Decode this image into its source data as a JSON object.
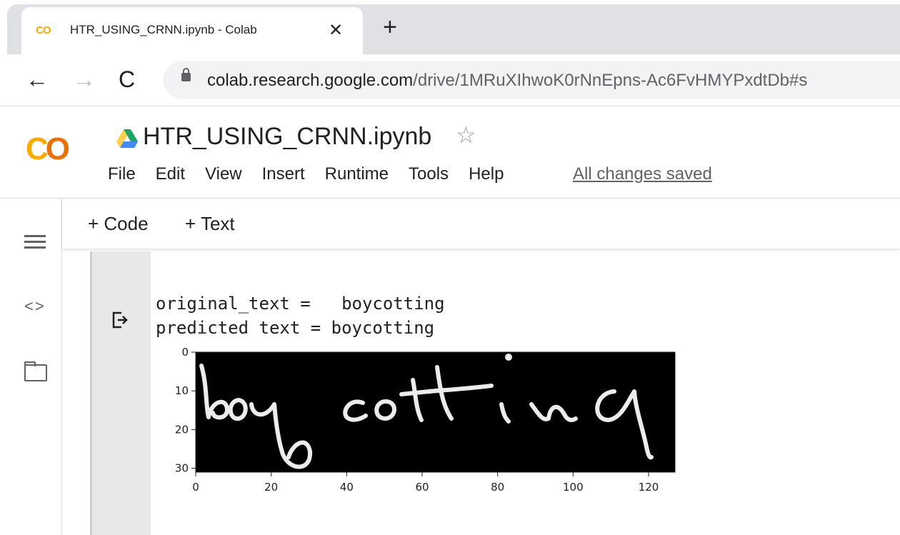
{
  "browser": {
    "tab": {
      "favicon": "CO",
      "title": "HTR_USING_CRNN.ipynb - Colab",
      "close_icon": "✕"
    },
    "new_tab_icon": "+",
    "back_icon": "←",
    "forward_icon": "→",
    "reload_icon": "C",
    "url_host": "colab.research.google.com",
    "url_path": "/drive/1MRuXIhwoK0rNnEpns-Ac6FvHMYPxdtDb#s"
  },
  "colab": {
    "logo": {
      "c": "C",
      "o": "O"
    },
    "notebook_title": "HTR_USING_CRNN.ipynb",
    "star_icon": "☆",
    "menu": [
      "File",
      "Edit",
      "View",
      "Insert",
      "Runtime",
      "Tools",
      "Help"
    ],
    "save_status": "All changes saved",
    "toolbar": {
      "add_code": "+ Code",
      "add_text": "+ Text"
    },
    "sidebar_icons": [
      "table-of-contents-icon",
      "code-snippets-icon",
      "files-icon"
    ],
    "code_icon_glyph": "<>"
  },
  "cell_output": {
    "line1": "original_text =   boycotting",
    "line2": "predicted text = boycotting",
    "handwritten_word": "boycotting"
  },
  "chart_data": {
    "type": "image",
    "xticks": [
      0,
      20,
      40,
      60,
      80,
      100,
      120
    ],
    "yticks": [
      0,
      10,
      20,
      30
    ],
    "xlim": [
      0,
      127
    ],
    "ylim": [
      31,
      0
    ],
    "colors": {
      "background": "#000000",
      "ink": "#ffffff"
    }
  }
}
